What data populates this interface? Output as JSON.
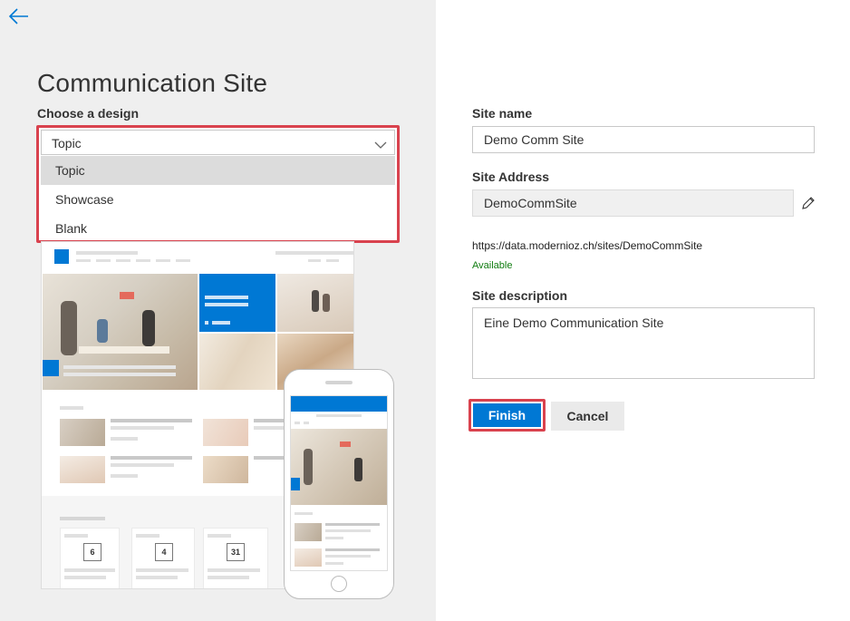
{
  "panel": {
    "title": "Communication Site",
    "choose_label": "Choose a design",
    "design": {
      "selected": "Topic",
      "options": [
        "Topic",
        "Showcase",
        "Blank"
      ]
    }
  },
  "preview": {
    "card_numbers": [
      "6",
      "4",
      "31"
    ]
  },
  "form": {
    "site_name_label": "Site name",
    "site_name_value": "Demo Comm Site",
    "site_address_label": "Site Address",
    "site_address_value": "DemoCommSite",
    "site_url": "https://data.modernioz.ch/sites/DemoCommSite",
    "availability": "Available",
    "description_label": "Site description",
    "description_value": "Eine Demo Communication Site",
    "finish_label": "Finish",
    "cancel_label": "Cancel"
  },
  "icons": {
    "back": "arrow-left-icon",
    "chevron": "chevron-down-icon",
    "edit": "pencil-icon"
  },
  "colors": {
    "accent": "#0078d4",
    "highlight_border": "#d9424e",
    "available": "#107c10",
    "left_panel_bg": "#efefef"
  }
}
